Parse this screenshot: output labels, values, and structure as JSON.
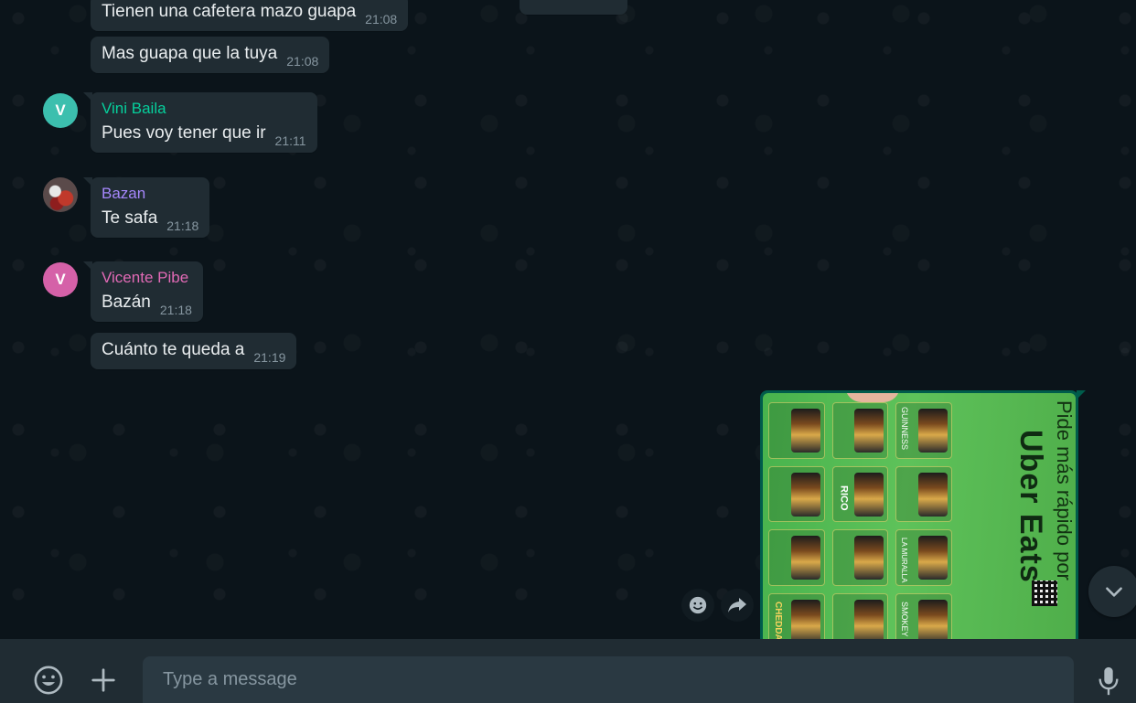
{
  "messages": [
    {
      "text": "Tienen una cafetera mazo guapa",
      "time": "21:08"
    },
    {
      "text": "Mas guapa que la tuya",
      "time": "21:08"
    },
    {
      "sender": "Vini Baila",
      "sender_color": "#06cf9c",
      "avatar_letter": "V",
      "avatar_color": "#3cbfae",
      "text": "Pues voy tener que ir",
      "time": "21:11"
    },
    {
      "sender": "Bazan",
      "sender_color": "#a587fb",
      "text": "Te safa",
      "time": "21:18"
    },
    {
      "sender": "Vicente Pibe",
      "sender_color": "#e26ab6",
      "avatar_letter": "V",
      "avatar_color": "#d561a8",
      "text": "Bazán",
      "time": "21:18"
    },
    {
      "text": "Cuánto te queda a",
      "time": "21:19"
    }
  ],
  "image_message": {
    "headline": "Pide más rápido por",
    "brand": "Uber Eats",
    "menu_labels": [
      "GUINNESS",
      "RICO",
      "LA MURALLA",
      "CHEDDAR",
      "SMOKEY"
    ]
  },
  "composer": {
    "placeholder": "Type a message"
  },
  "colors": {
    "background": "#0b141a",
    "incoming_bubble": "#202c33",
    "outgoing_bubble": "#005c4b",
    "composer_bar": "#202c33",
    "input_field": "#2a3942"
  },
  "icons": [
    "emoji-icon",
    "plus-icon",
    "microphone-icon",
    "chevron-down-icon",
    "smiley-react-icon",
    "forward-icon"
  ]
}
